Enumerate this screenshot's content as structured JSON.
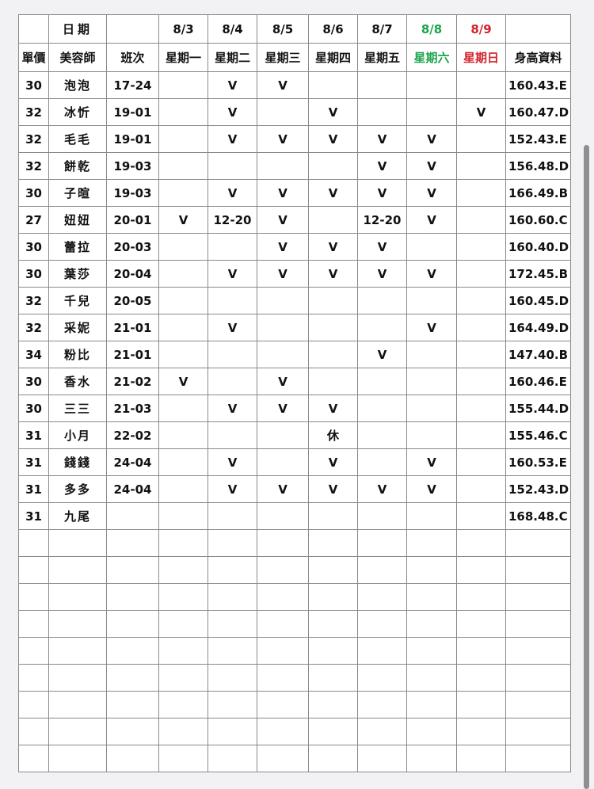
{
  "header": {
    "date_label": "日期",
    "dates": [
      "8/3",
      "8/4",
      "8/5",
      "8/6",
      "8/7",
      "8/8",
      "8/9"
    ],
    "price_label": "單價",
    "beautician_label": "美容師",
    "shift_label": "班次",
    "weekdays": [
      "星期一",
      "星期二",
      "星期三",
      "星期四",
      "星期五",
      "星期六",
      "星期日"
    ],
    "height_label": "身高資料"
  },
  "colors": {
    "price": "#d2222a",
    "name": "#2a7bbf",
    "shift": "#7e3a9a",
    "weekday": "#1b3b8a",
    "saturday": "#1aa34a",
    "sunday": "#d2222a",
    "rest": "#d2222a"
  },
  "rows": [
    {
      "price": "30",
      "name": "泡泡",
      "shift": "17-24",
      "days": [
        "",
        "V",
        "V",
        "",
        "",
        "",
        ""
      ],
      "height": "160.43.E"
    },
    {
      "price": "32",
      "name": "冰忻",
      "shift": "19-01",
      "days": [
        "",
        "V",
        "",
        "V",
        "",
        "",
        "V"
      ],
      "height": "160.47.D"
    },
    {
      "price": "32",
      "name": "毛毛",
      "shift": "19-01",
      "days": [
        "",
        "V",
        "V",
        "V",
        "V",
        "V",
        ""
      ],
      "height": "152.43.E"
    },
    {
      "price": "32",
      "name": "餅乾",
      "shift": "19-03",
      "days": [
        "",
        "",
        "",
        "",
        "V",
        "V",
        ""
      ],
      "height": "156.48.D"
    },
    {
      "price": "30",
      "name": "子暄",
      "shift": "19-03",
      "days": [
        "",
        "V",
        "V",
        "V",
        "V",
        "V",
        ""
      ],
      "height": "166.49.B"
    },
    {
      "price": "27",
      "name": "妞妞",
      "shift": "20-01",
      "days": [
        "V",
        "12-20",
        "V",
        "",
        "12-20",
        "V",
        ""
      ],
      "height": "160.60.C"
    },
    {
      "price": "30",
      "name": "蕾拉",
      "shift": "20-03",
      "days": [
        "",
        "",
        "V",
        "V",
        "V",
        "",
        ""
      ],
      "height": "160.40.D"
    },
    {
      "price": "30",
      "name": "葉莎",
      "shift": "20-04",
      "days": [
        "",
        "V",
        "V",
        "V",
        "V",
        "V",
        ""
      ],
      "height": "172.45.B"
    },
    {
      "price": "32",
      "name": "千兒",
      "shift": "20-05",
      "days": [
        "",
        "",
        "",
        "",
        "",
        "",
        ""
      ],
      "height": "160.45.D"
    },
    {
      "price": "32",
      "name": "采妮",
      "shift": "21-01",
      "days": [
        "",
        "V",
        "",
        "",
        "",
        "V",
        ""
      ],
      "height": "164.49.D"
    },
    {
      "price": "34",
      "name": "粉比",
      "shift": "21-01",
      "days": [
        "",
        "",
        "",
        "",
        "V",
        "",
        ""
      ],
      "height": "147.40.B"
    },
    {
      "price": "30",
      "name": "香水",
      "shift": "21-02",
      "days": [
        "V",
        "",
        "V",
        "",
        "",
        "",
        ""
      ],
      "height": "160.46.E"
    },
    {
      "price": "30",
      "name": "三三",
      "shift": "21-03",
      "days": [
        "",
        "V",
        "V",
        "V",
        "",
        "",
        ""
      ],
      "height": "155.44.D"
    },
    {
      "price": "31",
      "name": "小月",
      "shift": "22-02",
      "days": [
        "",
        "",
        "",
        "休",
        "",
        "",
        ""
      ],
      "height": "155.46.C"
    },
    {
      "price": "31",
      "name": "錢錢",
      "shift": "24-04",
      "days": [
        "",
        "V",
        "",
        "V",
        "",
        "V",
        ""
      ],
      "height": "160.53.E"
    },
    {
      "price": "31",
      "name": "多多",
      "shift": "24-04",
      "days": [
        "",
        "V",
        "V",
        "V",
        "V",
        "V",
        ""
      ],
      "height": "152.43.D"
    },
    {
      "price": "31",
      "name": "九尾",
      "shift": "",
      "days": [
        "",
        "",
        "",
        "",
        "",
        "",
        ""
      ],
      "height": "168.48.C"
    }
  ],
  "empty_rows": 9
}
